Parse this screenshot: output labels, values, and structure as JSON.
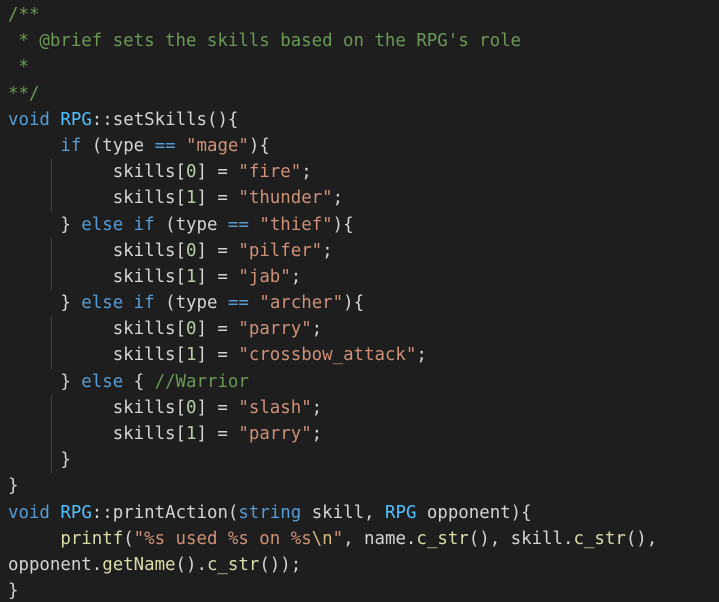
{
  "theme": {
    "background": "#1e1e1e",
    "default_text": "#d4d4d4",
    "comment": "#6a9955",
    "keyword": "#569cd6",
    "class": "#4fc1ff",
    "function": "#dcdcaa",
    "string": "#ce9178",
    "number": "#b5cea8",
    "escape": "#d7ba7d"
  },
  "code_lines": [
    {
      "guides": 0,
      "tokens": [
        {
          "t": "/**",
          "c": "comment"
        }
      ]
    },
    {
      "guides": 0,
      "tokens": [
        {
          "t": " * @brief sets the skills based on the RPG's role",
          "c": "comment"
        }
      ]
    },
    {
      "guides": 0,
      "tokens": [
        {
          "t": " *",
          "c": "comment"
        }
      ]
    },
    {
      "guides": 0,
      "tokens": [
        {
          "t": "**/",
          "c": "comment"
        }
      ]
    },
    {
      "guides": 0,
      "tokens": [
        {
          "t": "void",
          "c": "keyword"
        },
        {
          "t": " ",
          "c": "plain"
        },
        {
          "t": "RPG",
          "c": "class"
        },
        {
          "t": "::",
          "c": "plain"
        },
        {
          "t": "setSkills",
          "c": "plain"
        },
        {
          "t": "(){",
          "c": "plain"
        }
      ]
    },
    {
      "guides": 0,
      "tokens": [
        {
          "t": "     ",
          "c": "plain"
        },
        {
          "t": "if",
          "c": "keyword"
        },
        {
          "t": " (type ",
          "c": "plain"
        },
        {
          "t": "==",
          "c": "keyword"
        },
        {
          "t": " ",
          "c": "plain"
        },
        {
          "t": "\"mage\"",
          "c": "string"
        },
        {
          "t": "){",
          "c": "plain"
        }
      ]
    },
    {
      "guides": 1,
      "tokens": [
        {
          "t": "          skills[",
          "c": "plain"
        },
        {
          "t": "0",
          "c": "number"
        },
        {
          "t": "] = ",
          "c": "plain"
        },
        {
          "t": "\"fire\"",
          "c": "string"
        },
        {
          "t": ";",
          "c": "plain"
        }
      ]
    },
    {
      "guides": 1,
      "tokens": [
        {
          "t": "          skills[",
          "c": "plain"
        },
        {
          "t": "1",
          "c": "number"
        },
        {
          "t": "] = ",
          "c": "plain"
        },
        {
          "t": "\"thunder\"",
          "c": "string"
        },
        {
          "t": ";",
          "c": "plain"
        }
      ]
    },
    {
      "guides": 0,
      "tokens": [
        {
          "t": "     } ",
          "c": "plain"
        },
        {
          "t": "else",
          "c": "keyword"
        },
        {
          "t": " ",
          "c": "plain"
        },
        {
          "t": "if",
          "c": "keyword"
        },
        {
          "t": " (type ",
          "c": "plain"
        },
        {
          "t": "==",
          "c": "keyword"
        },
        {
          "t": " ",
          "c": "plain"
        },
        {
          "t": "\"thief\"",
          "c": "string"
        },
        {
          "t": "){",
          "c": "plain"
        }
      ]
    },
    {
      "guides": 1,
      "tokens": [
        {
          "t": "          skills[",
          "c": "plain"
        },
        {
          "t": "0",
          "c": "number"
        },
        {
          "t": "] = ",
          "c": "plain"
        },
        {
          "t": "\"pilfer\"",
          "c": "string"
        },
        {
          "t": ";",
          "c": "plain"
        }
      ]
    },
    {
      "guides": 1,
      "tokens": [
        {
          "t": "          skills[",
          "c": "plain"
        },
        {
          "t": "1",
          "c": "number"
        },
        {
          "t": "] = ",
          "c": "plain"
        },
        {
          "t": "\"jab\"",
          "c": "string"
        },
        {
          "t": ";",
          "c": "plain"
        }
      ]
    },
    {
      "guides": 0,
      "tokens": [
        {
          "t": "     } ",
          "c": "plain"
        },
        {
          "t": "else",
          "c": "keyword"
        },
        {
          "t": " ",
          "c": "plain"
        },
        {
          "t": "if",
          "c": "keyword"
        },
        {
          "t": " (type ",
          "c": "plain"
        },
        {
          "t": "==",
          "c": "keyword"
        },
        {
          "t": " ",
          "c": "plain"
        },
        {
          "t": "\"archer\"",
          "c": "string"
        },
        {
          "t": "){",
          "c": "plain"
        }
      ]
    },
    {
      "guides": 1,
      "tokens": [
        {
          "t": "          skills[",
          "c": "plain"
        },
        {
          "t": "0",
          "c": "number"
        },
        {
          "t": "] = ",
          "c": "plain"
        },
        {
          "t": "\"parry\"",
          "c": "string"
        },
        {
          "t": ";",
          "c": "plain"
        }
      ]
    },
    {
      "guides": 1,
      "tokens": [
        {
          "t": "          skills[",
          "c": "plain"
        },
        {
          "t": "1",
          "c": "number"
        },
        {
          "t": "] = ",
          "c": "plain"
        },
        {
          "t": "\"crossbow_attack\"",
          "c": "string"
        },
        {
          "t": ";",
          "c": "plain"
        }
      ]
    },
    {
      "guides": 0,
      "tokens": [
        {
          "t": "     } ",
          "c": "plain"
        },
        {
          "t": "else",
          "c": "keyword"
        },
        {
          "t": " { ",
          "c": "plain"
        },
        {
          "t": "//Warrior",
          "c": "comment"
        }
      ]
    },
    {
      "guides": 1,
      "tokens": [
        {
          "t": "          skills[",
          "c": "plain"
        },
        {
          "t": "0",
          "c": "number"
        },
        {
          "t": "] = ",
          "c": "plain"
        },
        {
          "t": "\"slash\"",
          "c": "string"
        },
        {
          "t": ";",
          "c": "plain"
        }
      ]
    },
    {
      "guides": 1,
      "tokens": [
        {
          "t": "          skills[",
          "c": "plain"
        },
        {
          "t": "1",
          "c": "number"
        },
        {
          "t": "] = ",
          "c": "plain"
        },
        {
          "t": "\"parry\"",
          "c": "string"
        },
        {
          "t": ";",
          "c": "plain"
        }
      ]
    },
    {
      "guides": 1,
      "tokens": [
        {
          "t": "     }",
          "c": "plain"
        }
      ]
    },
    {
      "guides": 0,
      "tokens": [
        {
          "t": "}",
          "c": "plain"
        }
      ]
    },
    {
      "guides": 0,
      "tokens": [
        {
          "t": "void",
          "c": "keyword"
        },
        {
          "t": " ",
          "c": "plain"
        },
        {
          "t": "RPG",
          "c": "class"
        },
        {
          "t": "::",
          "c": "plain"
        },
        {
          "t": "printAction",
          "c": "plain"
        },
        {
          "t": "(",
          "c": "plain"
        },
        {
          "t": "string",
          "c": "keyword"
        },
        {
          "t": " skill, ",
          "c": "plain"
        },
        {
          "t": "RPG",
          "c": "class"
        },
        {
          "t": " opponent){",
          "c": "plain"
        }
      ]
    },
    {
      "guides": 0,
      "tokens": [
        {
          "t": "     ",
          "c": "plain"
        },
        {
          "t": "printf",
          "c": "func"
        },
        {
          "t": "(",
          "c": "plain"
        },
        {
          "t": "\"%s used %s on %s",
          "c": "string"
        },
        {
          "t": "\\n",
          "c": "escape"
        },
        {
          "t": "\"",
          "c": "string"
        },
        {
          "t": ", name.",
          "c": "plain"
        },
        {
          "t": "c_str",
          "c": "func"
        },
        {
          "t": "(), skill.",
          "c": "plain"
        },
        {
          "t": "c_str",
          "c": "func"
        },
        {
          "t": "(),",
          "c": "plain"
        }
      ]
    },
    {
      "guides": 0,
      "tokens": [
        {
          "t": "opponent.",
          "c": "plain"
        },
        {
          "t": "getName",
          "c": "func"
        },
        {
          "t": "().",
          "c": "plain"
        },
        {
          "t": "c_str",
          "c": "func"
        },
        {
          "t": "());",
          "c": "plain"
        }
      ]
    },
    {
      "guides": 0,
      "tokens": [
        {
          "t": "}",
          "c": "plain"
        }
      ]
    }
  ]
}
